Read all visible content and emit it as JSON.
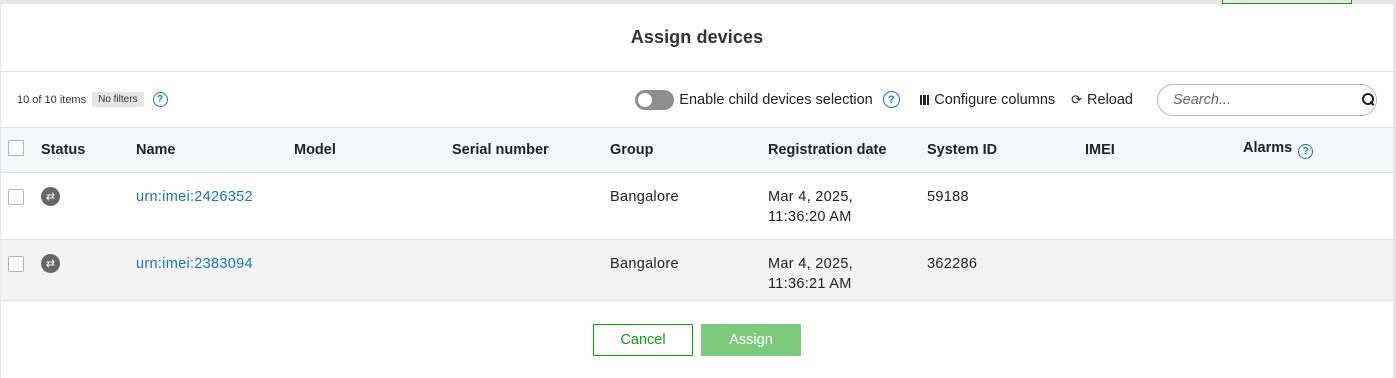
{
  "dialog": {
    "title": "Assign devices"
  },
  "toolbar": {
    "count": "10 of 10 items",
    "filters_badge": "No filters",
    "help_glyph": "?",
    "toggle_label": "Enable child devices selection",
    "toggle_on": false,
    "configure_columns": "Configure columns",
    "reload": "Reload",
    "search_placeholder": "Search..."
  },
  "table": {
    "columns": [
      "Status",
      "Name",
      "Model",
      "Serial number",
      "Group",
      "Registration date",
      "System ID",
      "IMEI",
      "Alarms"
    ],
    "rows": [
      {
        "status_icon": "sync-icon",
        "name": "urn:imei:2426352",
        "model": "",
        "serial": "",
        "group": "Bangalore",
        "reg_date_line1": "Mar 4, 2025,",
        "reg_date_line2": "11:36:20 AM",
        "system_id": "59188",
        "imei": "",
        "alarms": ""
      },
      {
        "status_icon": "sync-icon",
        "name": "urn:imei:2383094",
        "model": "",
        "serial": "",
        "group": "Bangalore",
        "reg_date_line1": "Mar 4, 2025,",
        "reg_date_line2": "11:36:21 AM",
        "system_id": "362286",
        "imei": "",
        "alarms": ""
      }
    ]
  },
  "footer": {
    "cancel": "Cancel",
    "assign": "Assign"
  },
  "colors": {
    "link": "#1776bf",
    "primary_green": "#119d11",
    "assign_disabled": "#7dca7d",
    "toggle_off": "#8e8e8e"
  }
}
